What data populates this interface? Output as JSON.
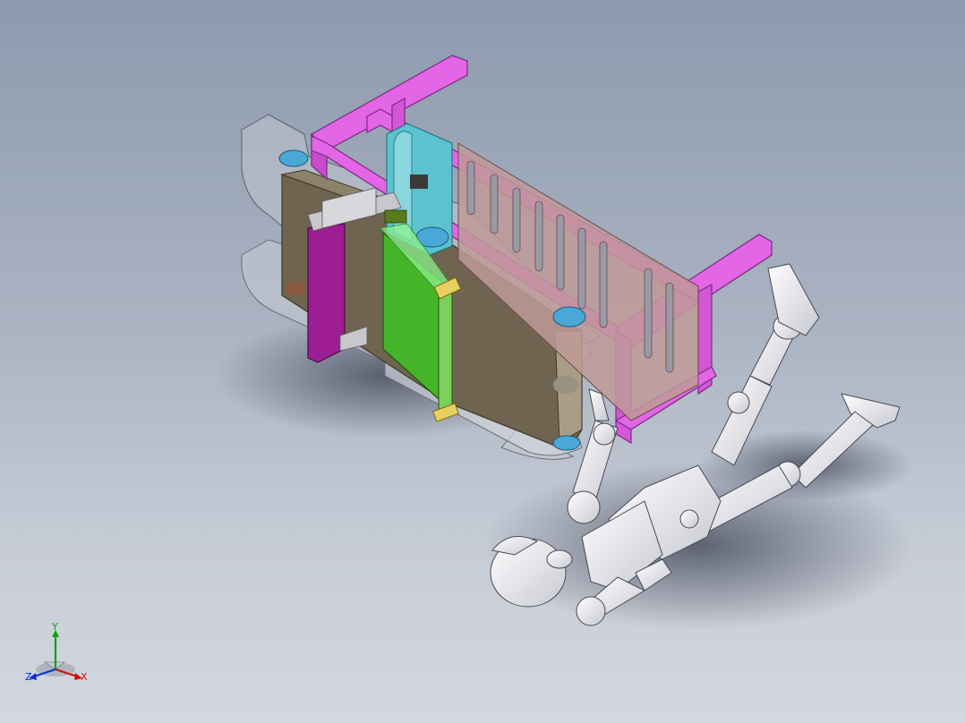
{
  "viewport": {
    "background_top": "#8d9aae",
    "background_bottom": "#d3d7de"
  },
  "model": {
    "frame_color": "#e266e6",
    "body_color": "#6f6450",
    "green_panel_color": "#46b428",
    "purple_panel_color": "#9c1e92",
    "cyan_part_color": "#5ac3cf",
    "mannequin_color": "#ececf0"
  },
  "triad": {
    "x_label": "X",
    "y_label": "Y",
    "z_label": "Z",
    "x_color": "#cc1010",
    "y_color": "#10a010",
    "z_color": "#1030d0"
  }
}
